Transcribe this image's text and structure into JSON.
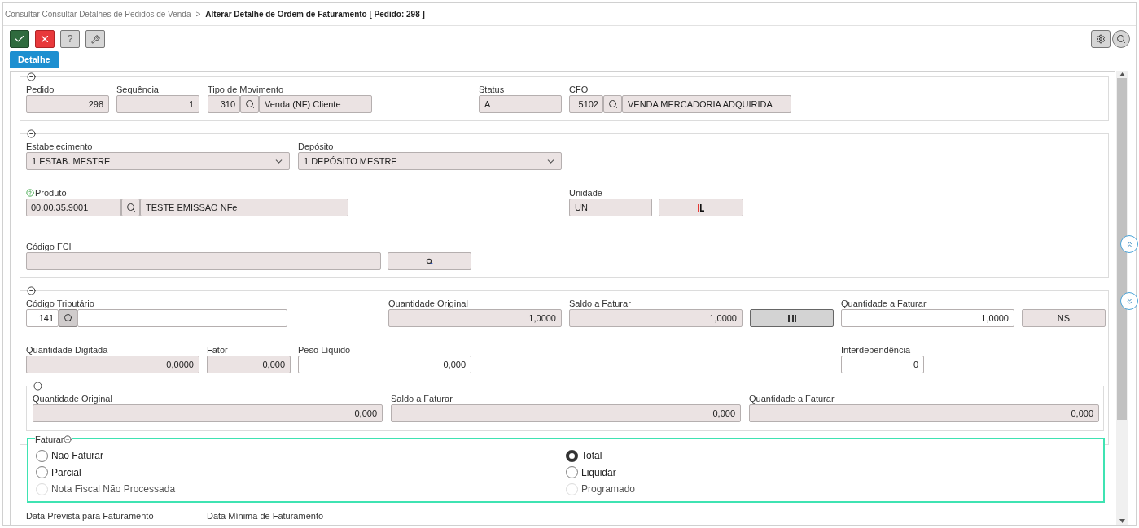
{
  "breadcrumb": {
    "parent": "Consultar Consultar Detalhes de Pedidos de Venda",
    "separator": ">",
    "current": "Alterar Detalhe de Ordem de Faturamento [ Pedido: 298 ]"
  },
  "toolbar": [
    {
      "kind": "confirm"
    },
    {
      "kind": "cancel"
    },
    {
      "kind": "help",
      "label": "?"
    },
    {
      "kind": "tools"
    }
  ],
  "toolbar_right": [
    {
      "kind": "settings"
    },
    {
      "kind": "search"
    }
  ],
  "tabs": [
    {
      "label": "Detalhe",
      "selected": true
    }
  ],
  "sections": [
    {
      "rows": [
        [
          {
            "kind": "text",
            "label": "Pedido",
            "value": "298",
            "editable": false
          },
          {
            "kind": "text",
            "label": "Sequência",
            "value": "1",
            "editable": false
          },
          {
            "kind": "lookup",
            "label": "Tipo de Movimento",
            "code": "310",
            "description": "Venda (NF) Cliente",
            "editable": false
          },
          {
            "kind": "text",
            "label": "Status",
            "value": "A",
            "editable": false
          },
          {
            "kind": "lookup",
            "label": "CFO",
            "code": "5102",
            "description": "VENDA MERCADORIA ADQUIRIDA",
            "editable": false
          }
        ]
      ]
    },
    {
      "rows": [
        [
          {
            "kind": "select",
            "label": "Estabelecimento",
            "value": "1 ESTAB. MESTRE"
          },
          {
            "kind": "select",
            "label": "Depósito",
            "value": "1 DEPÓSITO MESTRE"
          }
        ],
        [
          {
            "kind": "lookup",
            "label": "Produto",
            "help": true,
            "code": "00.00.35.9001",
            "description": "TESTE EMISSAO  NFe",
            "editable": false
          },
          {
            "kind": "text",
            "label": "Unidade",
            "value": "UN",
            "editable": false
          },
          {
            "kind": "unit_button"
          }
        ],
        [
          {
            "kind": "text",
            "label": "Código FCI",
            "editable": false
          },
          {
            "kind": "fci_button"
          }
        ]
      ]
    },
    {
      "rows": [
        [
          {
            "kind": "lookup",
            "label": "Código Tributário",
            "code": "141",
            "editable": true
          },
          {
            "kind": "text",
            "label": "Quantidade Original",
            "value": "1,0000",
            "editable": false
          },
          {
            "kind": "text",
            "label": "Saldo a Faturar",
            "value": "1,0000",
            "editable": false
          },
          {
            "kind": "bars_button"
          },
          {
            "kind": "text",
            "label": "Quantidade a Faturar",
            "value": "1,0000",
            "editable": true
          },
          {
            "kind": "text_button",
            "value": "NS"
          }
        ],
        [
          {
            "kind": "text",
            "label": "Quantidade Digitada",
            "value": "0,0000",
            "editable": false
          },
          {
            "kind": "text",
            "label": "Fator",
            "value": "0,000",
            "editable": false
          },
          {
            "kind": "text",
            "label": "Peso Líquido",
            "value": "0,000",
            "editable": true
          },
          {
            "kind": "text",
            "label": "Interdependência",
            "value": "0",
            "editable": true
          }
        ]
      ],
      "subsection": [
        {
          "kind": "text",
          "label": "Quantidade Original",
          "value": "0,000",
          "editable": false
        },
        {
          "kind": "text",
          "label": "Saldo a Faturar",
          "value": "0,000",
          "editable": false
        },
        {
          "kind": "text",
          "label": "Quantidade a Faturar",
          "value": "0,000",
          "editable": false
        }
      ]
    }
  ],
  "faturar": {
    "legend": "Faturar",
    "columns": [
      [
        {
          "label": "Não Faturar",
          "selected": false,
          "disabled": false
        },
        {
          "label": "Parcial",
          "selected": false,
          "disabled": false
        },
        {
          "label": "Nota Fiscal Não Processada",
          "selected": false,
          "disabled": true
        }
      ],
      [
        {
          "label": "Total",
          "selected": true,
          "disabled": false
        },
        {
          "label": "Liquidar",
          "selected": false,
          "disabled": false
        },
        {
          "label": "Programado",
          "selected": false,
          "disabled": true
        }
      ]
    ]
  },
  "dates": [
    {
      "label": "Data Prevista para Faturamento"
    },
    {
      "label": "Data Mínima de Faturamento"
    }
  ]
}
